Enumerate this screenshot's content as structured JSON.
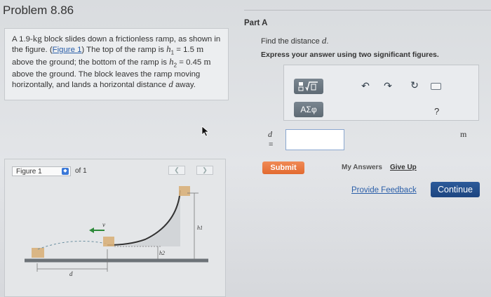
{
  "problem": {
    "title": "Problem 8.86",
    "text": {
      "s1": "A 1.9-",
      "s1_unit": "kg",
      "s2": " block slides down a frictionless ramp, as shown in the figure. (",
      "figure_link": "Figure 1",
      "s3": ") The top of the ramp is ",
      "h1": "h",
      "h1_sub": "1",
      "s4": " = 1.5 ",
      "m1": "m",
      "s5": " above the ground; the bottom of the ramp is ",
      "h2": "h",
      "h2_sub": "2",
      "s6": " = 0.45 ",
      "m2": "m",
      "s7": " above the ground. The block leaves the ramp moving horizontally, and lands a horizontal distance ",
      "d": "d",
      "s8": " away."
    }
  },
  "figure": {
    "selected": "Figure 1",
    "of_label": "of 1",
    "prev_icon": "chevron-left-icon",
    "next_icon": "chevron-right-icon",
    "label_v": "v",
    "label_h1": "h1",
    "label_h2": "h2",
    "label_d": "d"
  },
  "part": {
    "label": "Part A",
    "find_prefix": "Find the distance ",
    "find_var": "d",
    "find_suffix": ".",
    "instruction": "Express your answer using two significant figures."
  },
  "editor": {
    "templates_icon": "fraction-sqrt-template-icon",
    "symbols_label": "ΑΣφ",
    "undo_icon": "undo-icon",
    "redo_icon": "redo-icon",
    "reset_icon": "reset-icon",
    "keyboard_icon": "keyboard-icon",
    "help_label": "?"
  },
  "answer": {
    "variable": "d",
    "equals": "=",
    "value": "",
    "unit": "m"
  },
  "actions": {
    "submit": "Submit",
    "my_answers": "My Answers",
    "give_up": "Give Up",
    "feedback": "Provide Feedback",
    "continue": "Continue"
  },
  "colors": {
    "submit": "#e8773e",
    "continue": "#234f8c",
    "link": "#2a5ea8",
    "toolbar_button": "#6b7780"
  }
}
